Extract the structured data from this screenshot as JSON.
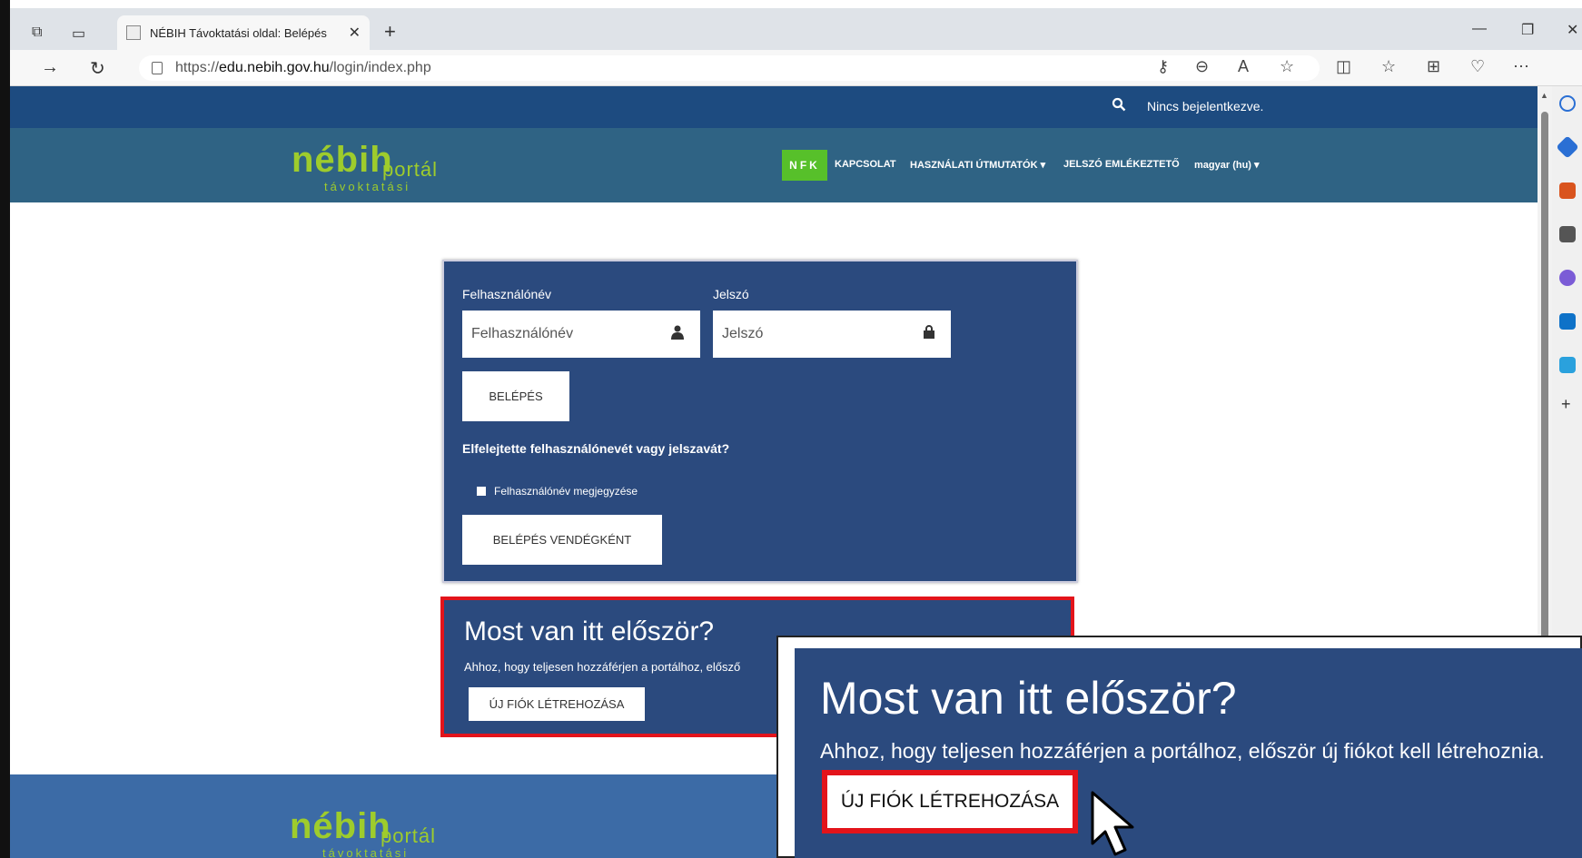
{
  "browser": {
    "tab_title": "NÉBIH Távoktatási oldal: Belépés",
    "tab_close": "✕",
    "new_tab": "+",
    "url_prefix": "https://",
    "url_host": "edu.nebih.gov.hu",
    "url_path": "/login/index.php"
  },
  "site": {
    "status": "Nincs bejelentkezve.",
    "logo": {
      "brand": "nébih",
      "portal": "portál",
      "sub": "távoktatási"
    },
    "nav": {
      "nfk": "NFK",
      "kapcsolat": "KAPCSOLAT",
      "utmutatok": "HASZNÁLATI ÚTMUTATÓK",
      "jelszo": "JELSZÓ EMLÉKEZTETŐ",
      "lang": "magyar (hu)",
      "caret": "▾"
    }
  },
  "login": {
    "username_label": "Felhasználónév",
    "username_placeholder": "Felhasználónév",
    "password_label": "Jelszó",
    "password_placeholder": "Jelszó",
    "login_button": "BELÉPÉS",
    "forgot": "Elfelejtette felhasználónevét vagy jelszavát?",
    "remember": "Felhasználónév megjegyzése",
    "guest_button": "BELÉPÉS VENDÉGKÉNT"
  },
  "first_time": {
    "heading": "Most van itt először?",
    "text_truncated": "Ahhoz, hogy teljesen hozzáférjen a portálhoz, elősző",
    "button": "ÚJ FIÓK LÉTREHOZÁSA"
  },
  "zoom_callout": {
    "heading": "Most van itt először?",
    "text": "Ahhoz, hogy teljesen hozzáférjen a portálhoz, először új fiókot kell létrehoznia.",
    "button": "ÚJ FIÓK LÉTREHOZÁSA"
  },
  "colors": {
    "site_dark": "#1d4b80",
    "nav": "#2f6384",
    "card": "#2b4a7e",
    "highlight": "#e3141b",
    "nfk": "#57c02a"
  }
}
